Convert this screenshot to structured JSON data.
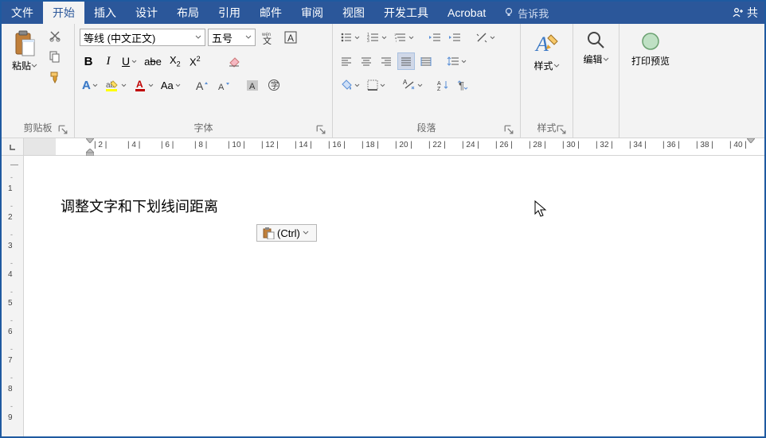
{
  "menubar": {
    "file": "文件",
    "home": "开始",
    "insert": "插入",
    "design": "设计",
    "layout": "布局",
    "references": "引用",
    "mailings": "邮件",
    "review": "审阅",
    "view": "视图",
    "developer": "开发工具",
    "acrobat": "Acrobat",
    "tellme": "告诉我",
    "share": "共"
  },
  "ribbon": {
    "clipboard": {
      "paste": "粘贴",
      "label": "剪贴板"
    },
    "font": {
      "name": "等线 (中文正文)",
      "size": "五号",
      "label": "字体"
    },
    "paragraph": {
      "label": "段落"
    },
    "styles": {
      "big": "样式",
      "label": "样式"
    },
    "editing": {
      "label": "编辑"
    },
    "printpreview": {
      "label": "打印预览"
    }
  },
  "ruler": {
    "ticks": [
      "2",
      "4",
      "6",
      "8",
      "10",
      "12",
      "14",
      "16",
      "18",
      "20",
      "22",
      "24",
      "26",
      "28",
      "30",
      "32",
      "34",
      "36",
      "38",
      "40"
    ]
  },
  "vruler": {
    "ticks": [
      "1",
      "2",
      "3",
      "4",
      "5",
      "6",
      "7",
      "8",
      "9"
    ]
  },
  "document": {
    "text": "调整文字和下划线间距离",
    "paste_options": "(Ctrl)"
  }
}
